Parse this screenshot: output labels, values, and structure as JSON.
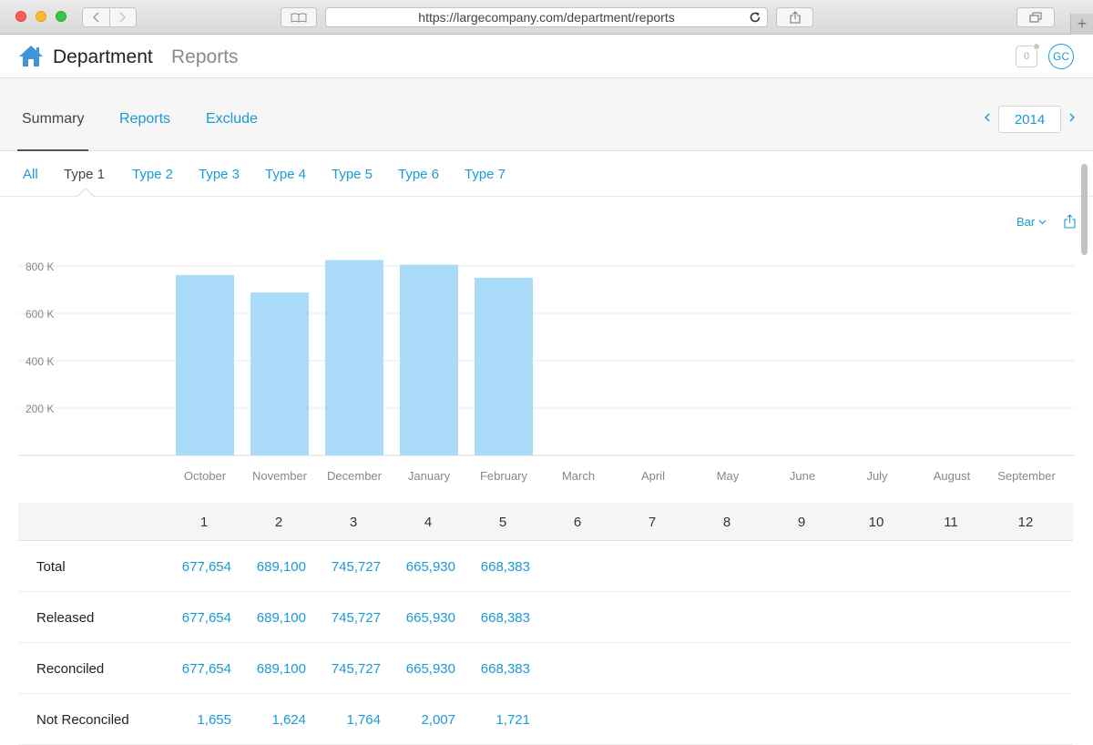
{
  "browser": {
    "url": "https://largecompany.com/department/reports"
  },
  "header": {
    "brand": "Department",
    "section": "Reports",
    "notification_count": "0",
    "avatar_initials": "GC"
  },
  "nav": {
    "tabs": [
      {
        "label": "Summary",
        "active": true
      },
      {
        "label": "Reports",
        "active": false
      },
      {
        "label": "Exclude",
        "active": false
      }
    ],
    "year": "2014"
  },
  "type_filters": [
    {
      "label": "All",
      "active": false
    },
    {
      "label": "Type 1",
      "active": true
    },
    {
      "label": "Type 2",
      "active": false
    },
    {
      "label": "Type 3",
      "active": false
    },
    {
      "label": "Type 4",
      "active": false
    },
    {
      "label": "Type 5",
      "active": false
    },
    {
      "label": "Type 6",
      "active": false
    },
    {
      "label": "Type 7",
      "active": false
    }
  ],
  "chart_controls": {
    "type_label": "Bar"
  },
  "colors": {
    "accent": "#1a9ad6",
    "bar": "#aadcf9",
    "grid": "#e8e8e8"
  },
  "chart_data": {
    "type": "bar",
    "categories": [
      "October",
      "November",
      "December",
      "January",
      "February",
      "March",
      "April",
      "May",
      "June",
      "July",
      "August",
      "September"
    ],
    "values": [
      762000,
      688000,
      825000,
      805000,
      750000,
      null,
      null,
      null,
      null,
      null,
      null,
      null
    ],
    "yticks": [
      200000,
      400000,
      600000,
      800000
    ],
    "ytick_labels": [
      "200 K",
      "400 K",
      "600 K",
      "800 K"
    ],
    "ylim": [
      0,
      800000
    ],
    "grid": true,
    "legend": "none"
  },
  "table": {
    "columns": [
      "1",
      "2",
      "3",
      "4",
      "5",
      "6",
      "7",
      "8",
      "9",
      "10",
      "11",
      "12"
    ],
    "rows": [
      {
        "label": "Total",
        "values": [
          "677,654",
          "689,100",
          "745,727",
          "665,930",
          "668,383"
        ]
      },
      {
        "label": "Released",
        "values": [
          "677,654",
          "689,100",
          "745,727",
          "665,930",
          "668,383"
        ]
      },
      {
        "label": "Reconciled",
        "values": [
          "677,654",
          "689,100",
          "745,727",
          "665,930",
          "668,383"
        ]
      },
      {
        "label": "Not Reconciled",
        "values": [
          "1,655",
          "1,624",
          "1,764",
          "2,007",
          "1,721"
        ]
      }
    ]
  }
}
